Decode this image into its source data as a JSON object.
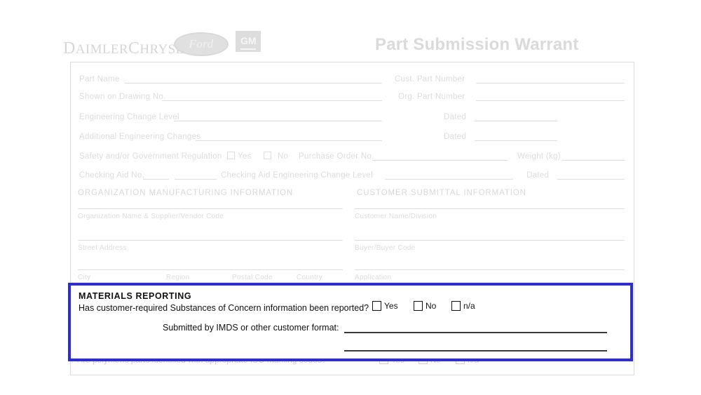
{
  "document": {
    "title": "Part Submission Warrant",
    "logos": [
      {
        "name": "daimlerchrysler-logo",
        "text": "DaimlerChrysler"
      },
      {
        "name": "ford-logo",
        "text": "Ford"
      },
      {
        "name": "gm-logo",
        "text": "GM"
      }
    ]
  },
  "part_info": {
    "part_name": "Part Name",
    "shown_on_drawing_no": "Shown on Drawing No.",
    "engineering_change_level": "Engineering Change Level",
    "additional_engineering_changes": "Additional Engineering Changes",
    "cust_part_number": "Cust.  Part Number",
    "org_part_number": "Org. Part Number",
    "dated_1": "Dated",
    "dated_2": "Dated"
  },
  "safety_row": {
    "label": "Safety and/or Government Regulation",
    "yes": "Yes",
    "no": "No",
    "purchase_order_no": "Purchase Order No.",
    "weight_kg": "Weight (kg)"
  },
  "checking_aid_row": {
    "checking_aid_no": "Checking Aid No.",
    "checking_aid_ecl": "Checking  Aid  Engineering  Change  Level",
    "dated": "Dated"
  },
  "sections": {
    "organization": "ORGANIZATION  MANUFACTURING  INFORMATION",
    "customer": "CUSTOMER  SUBMITTAL  INFORMATION"
  },
  "organization_fields": {
    "org_name": "Organization Name & Supplier/Vendor Code",
    "street_address": "Street Address",
    "city": "City",
    "region": "Region",
    "postal_code": "Postal Code",
    "country": "Country"
  },
  "customer_fields": {
    "customer_name": "Customer  Name/Division",
    "buyer_code": "Buyer/Buyer  Code",
    "application": "Application"
  },
  "materials_reporting": {
    "heading": "MATERIALS  REPORTING",
    "question": "Has customer-required Substances of Concern information been reported?",
    "options": [
      {
        "name": "yes",
        "label": "Yes",
        "checked": false
      },
      {
        "name": "no",
        "label": "No",
        "checked": false
      },
      {
        "name": "na",
        "label": "n/a",
        "checked": false
      }
    ],
    "submitted_label": "Submitted by IMDS or other customer format:",
    "submitted_value_1": "",
    "submitted_value_2": "",
    "highlight_color": "#2b2be0"
  },
  "polymeric_row": {
    "question": "Are polymeric parts identified with appropriate  ISO marking codes?",
    "options": [
      {
        "name": "yes",
        "label": "Yes"
      },
      {
        "name": "no",
        "label": "No"
      },
      {
        "name": "na",
        "label": "n/a"
      }
    ]
  }
}
